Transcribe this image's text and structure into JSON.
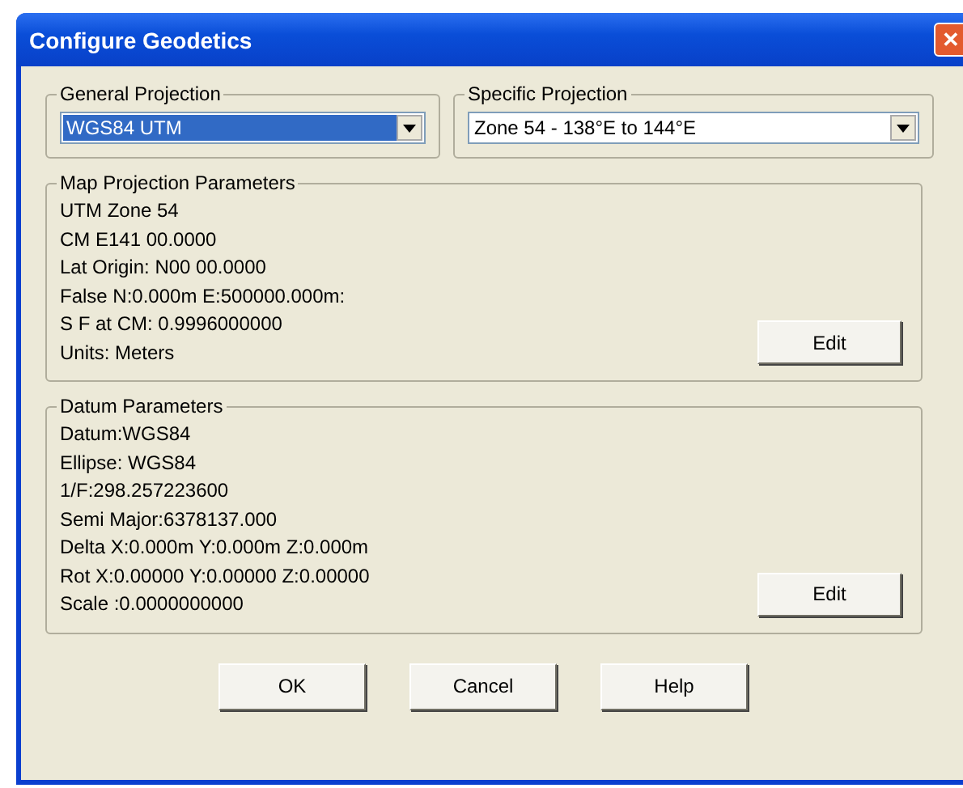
{
  "window": {
    "title": "Configure Geodetics",
    "close": "✕"
  },
  "selectors": [
    {
      "label": "General Projection",
      "value": "WGS84 UTM",
      "focused": true
    },
    {
      "label": "Specific Projection",
      "value": "Zone 54 - 138°E to 144°E",
      "focused": false
    }
  ],
  "groups": [
    {
      "title": "Map Projection Parameters",
      "lines": [
        "UTM Zone 54",
        "CM E141 00.0000",
        "Lat Origin: N00 00.0000",
        "False N:0.000m E:500000.000m:",
        "S F at CM: 0.9996000000",
        "Units: Meters"
      ],
      "button": "Edit"
    },
    {
      "title": "Datum Parameters",
      "lines": [
        "Datum:WGS84",
        "Ellipse: WGS84",
        "1/F:298.257223600",
        "Semi Major:6378137.000",
        "Delta X:0.000m  Y:0.000m  Z:0.000m",
        "Rot   X:0.00000  Y:0.00000  Z:0.00000",
        "Scale  :0.0000000000"
      ],
      "button": "Edit"
    }
  ],
  "buttons": [
    "OK",
    "Cancel",
    "Help"
  ]
}
